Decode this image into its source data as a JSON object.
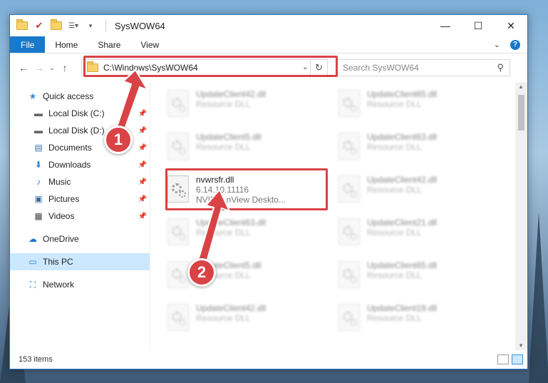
{
  "window": {
    "title": "SysWOW64",
    "controls": {
      "minimize": "—",
      "maximize": "☐",
      "close": "✕"
    }
  },
  "ribbon": {
    "tabs": [
      "File",
      "Home",
      "Share",
      "View"
    ]
  },
  "address": {
    "path": "C:\\Windows\\SysWOW64",
    "search_placeholder": "Search SysWOW64"
  },
  "sidebar": {
    "items": [
      {
        "label": "Quick access",
        "icon": "star-icon",
        "pinned": false
      },
      {
        "label": "Local Disk (C:)",
        "icon": "drive-icon",
        "pinned": true
      },
      {
        "label": "Local Disk (D:)",
        "icon": "drive-icon",
        "pinned": true
      },
      {
        "label": "Documents",
        "icon": "documents-icon",
        "pinned": true
      },
      {
        "label": "Downloads",
        "icon": "downloads-icon",
        "pinned": true
      },
      {
        "label": "Music",
        "icon": "music-icon",
        "pinned": true
      },
      {
        "label": "Pictures",
        "icon": "pictures-icon",
        "pinned": true
      },
      {
        "label": "Videos",
        "icon": "videos-icon",
        "pinned": true
      },
      {
        "label": "OneDrive",
        "icon": "onedrive-icon",
        "pinned": false
      },
      {
        "label": "This PC",
        "icon": "computer-icon",
        "pinned": false
      },
      {
        "label": "Network",
        "icon": "network-icon",
        "pinned": false
      }
    ]
  },
  "files": {
    "highlighted": {
      "name": "nvwrsfr.dll",
      "version": "6.14.10.11116",
      "description": "NVIDIA nView Deskto..."
    },
    "blurred": [
      {
        "name": "UpdateClient42.dll",
        "type": "Resource DLL"
      },
      {
        "name": "UpdateClient65.dll",
        "type": "Resource DLL"
      },
      {
        "name": "UpdateClient5.dll",
        "type": "Resource DLL"
      },
      {
        "name": "UpdateClient63.dll",
        "type": "Resource DLL"
      },
      {
        "name": "UpdateClient42.dll",
        "type": "Resource DLL"
      },
      {
        "name": "UpdateClient63.dll",
        "type": "Resource DLL"
      },
      {
        "name": "UpdateClient21.dll",
        "type": "Resource DLL"
      },
      {
        "name": "UpdateClient5.dll",
        "type": "Resource DLL"
      },
      {
        "name": "UpdateClient65.dll",
        "type": "Resource DLL"
      },
      {
        "name": "UpdateClient42.dll",
        "type": "Resource DLL"
      },
      {
        "name": "UpdateClient19.dll",
        "type": "Resource DLL"
      }
    ]
  },
  "status": {
    "item_count": "153 items"
  },
  "annotations": {
    "step1": "1",
    "step2": "2",
    "color": "#d94346"
  }
}
